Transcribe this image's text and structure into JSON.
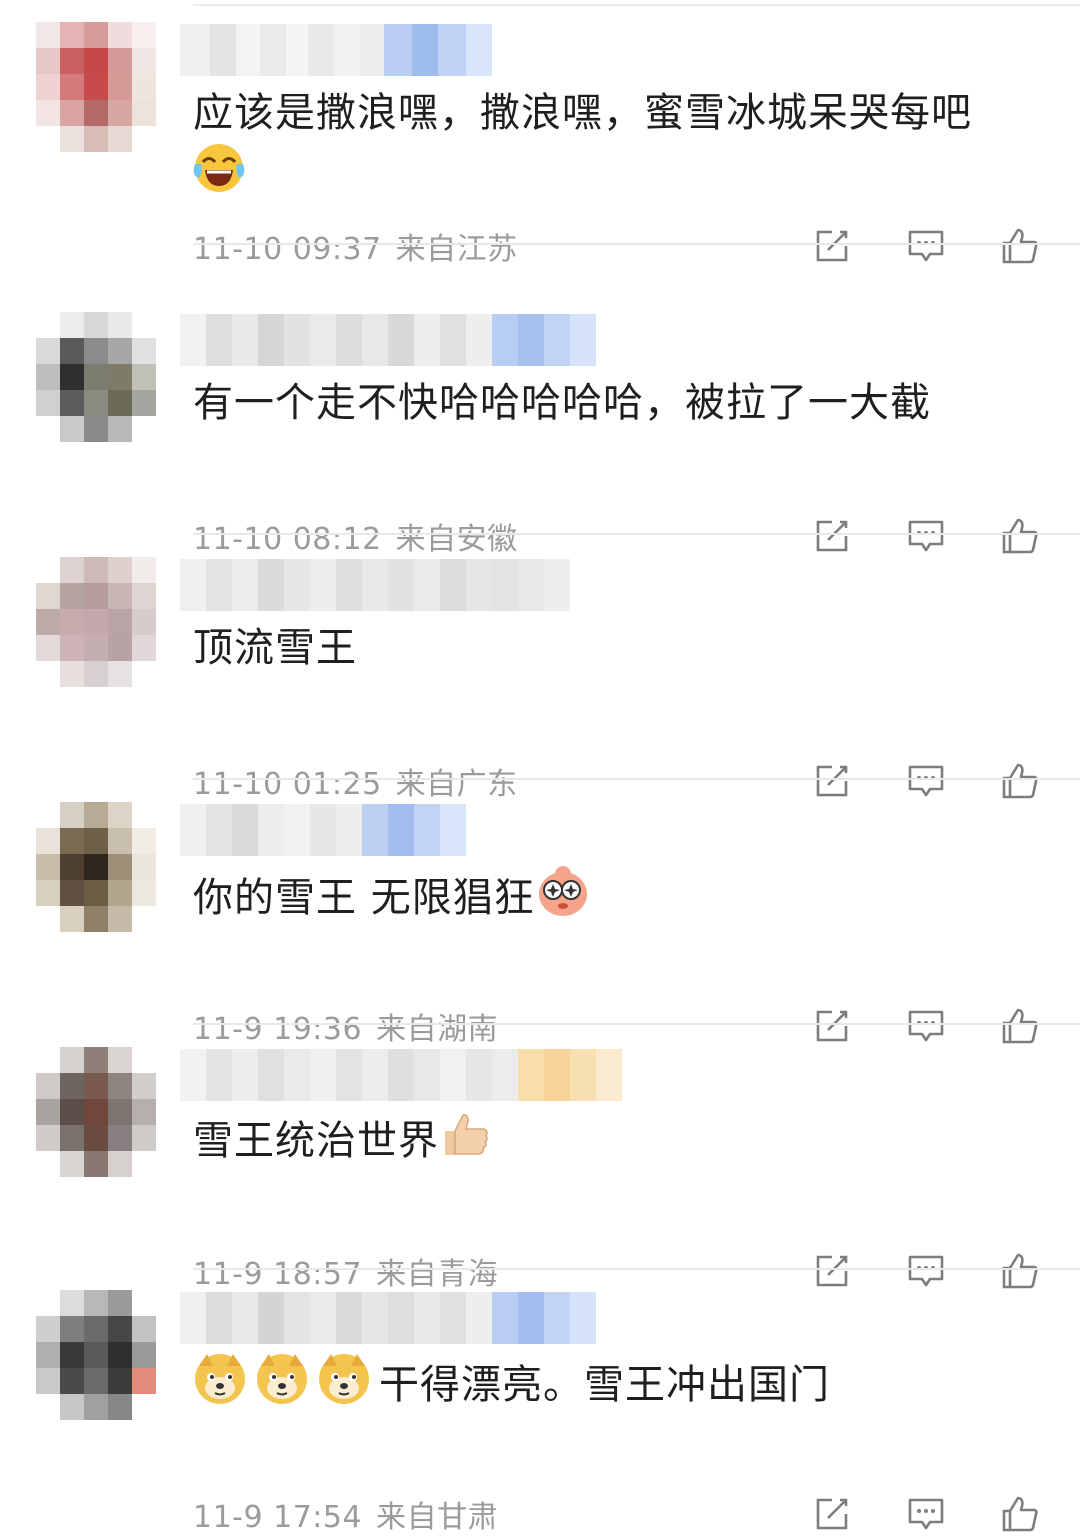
{
  "comments": [
    {
      "text": "应该是撒浪嘿，撒浪嘿，蜜雪冰城呆哭每吧",
      "time": "11-10 09:37",
      "location": "来自江苏",
      "emoji": "laugh-cry-emoji",
      "emoji_pos": "newline"
    },
    {
      "text": "有一个走不快哈哈哈哈哈，被拉了一大截",
      "time": "11-10 08:12",
      "location": "来自安徽",
      "emoji": ""
    },
    {
      "text": "顶流雪王",
      "time": "11-10 01:25",
      "location": "来自广东",
      "emoji": ""
    },
    {
      "text": "你的雪王 无限猖狂",
      "time": "11-9 19:36",
      "location": "来自湖南",
      "emoji": "starry-eyes-emoji",
      "emoji_pos": "after"
    },
    {
      "text": "雪王统治世界",
      "time": "11-9 18:57",
      "location": "来自青海",
      "emoji": "thumbs-up-emoji",
      "emoji_pos": "after"
    },
    {
      "text": "干得漂亮。雪王冲出国门",
      "time": "11-9 17:54",
      "location": "来自甘肃",
      "emoji": "doge-emoji",
      "emoji_pos": "before3"
    }
  ],
  "actions": [
    "share-icon",
    "comment-icon",
    "like-icon"
  ],
  "colors": {
    "text": "#1f1f1f",
    "meta": "#9b9b9b",
    "icon": "#7d7d7d",
    "divider": "#e8e8e8"
  }
}
